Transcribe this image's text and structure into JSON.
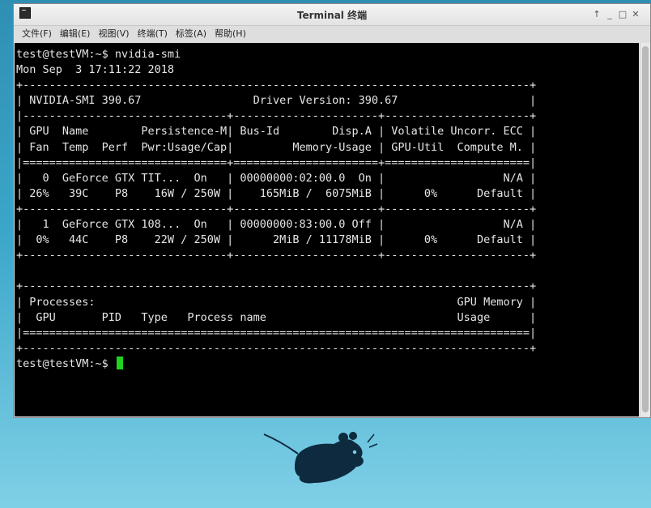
{
  "window": {
    "title": "Terminal 终端",
    "controls": [
      "↑",
      "_",
      "□",
      "✕"
    ]
  },
  "menu": [
    "文件(F)",
    "编辑(E)",
    "视图(V)",
    "终端(T)",
    "标签(A)",
    "帮助(H)"
  ],
  "terminal": {
    "lines": [
      "test@testVM:~$ nvidia-smi",
      "Mon Sep  3 17:11:22 2018",
      "+-----------------------------------------------------------------------------+",
      "| NVIDIA-SMI 390.67                 Driver Version: 390.67                    |",
      "|-------------------------------+----------------------+----------------------+",
      "| GPU  Name        Persistence-M| Bus-Id        Disp.A | Volatile Uncorr. ECC |",
      "| Fan  Temp  Perf  Pwr:Usage/Cap|         Memory-Usage | GPU-Util  Compute M. |",
      "|===============================+======================+======================|",
      "|   0  GeForce GTX TIT...  On   | 00000000:02:00.0  On |                  N/A |",
      "| 26%   39C    P8    16W / 250W |    165MiB /  6075MiB |      0%      Default |",
      "+-------------------------------+----------------------+----------------------+",
      "|   1  GeForce GTX 108...  On   | 00000000:83:00.0 Off |                  N/A |",
      "|  0%   44C    P8    22W / 250W |      2MiB / 11178MiB |      0%      Default |",
      "+-------------------------------+----------------------+----------------------+",
      "",
      "+-----------------------------------------------------------------------------+",
      "| Processes:                                                       GPU Memory |",
      "|  GPU       PID   Type   Process name                             Usage      |",
      "|=============================================================================|",
      "+-----------------------------------------------------------------------------+"
    ],
    "prompt": "test@testVM:~$ ",
    "cursor_color": "#1fd21f"
  },
  "desktop": {
    "logo_icon": "xfce-mouse-logo",
    "background_colors": [
      "#2f8fb3",
      "#7fd0e6"
    ]
  }
}
